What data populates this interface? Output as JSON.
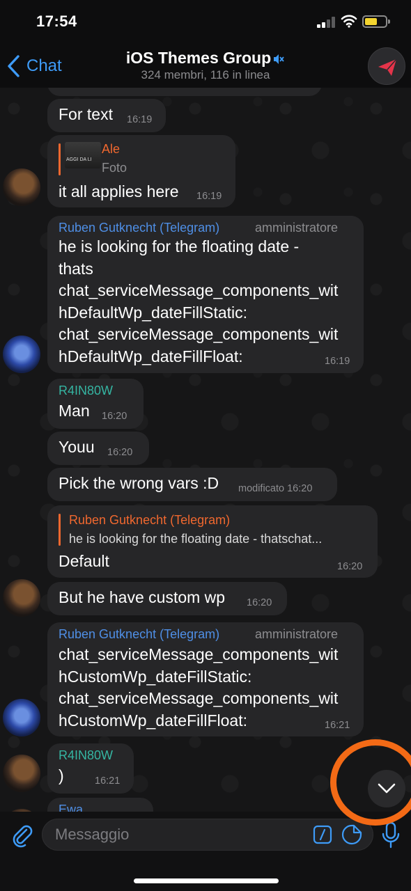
{
  "status": {
    "time": "17:54"
  },
  "nav": {
    "back_label": "Chat",
    "title": "iOS Themes Group",
    "subtitle": "324 membri, 116 in linea"
  },
  "messages": [
    {
      "text": "For text",
      "time": "16:19"
    },
    {
      "reply_name": "Ale",
      "reply_text": "Foto",
      "reply_thumb_text": "AGGI DA LI",
      "text": "it all applies here",
      "time": "16:19"
    },
    {
      "name": "Ruben Gutknecht (Telegram)",
      "role": "amministratore",
      "lines": [
        "he is looking for the floating date -",
        "thats",
        "chat_serviceMessage_components_wit",
        "hDefaultWp_dateFillStatic:",
        "chat_serviceMessage_components_wit",
        "hDefaultWp_dateFillFloat:"
      ],
      "time": "16:19"
    },
    {
      "name": "R4IN80W",
      "text": "Man",
      "time": "16:20"
    },
    {
      "text": "Youu",
      "time": "16:20"
    },
    {
      "text": "Pick the wrong vars :D",
      "time": "modificato 16:20"
    },
    {
      "reply_name": "Ruben Gutknecht (Telegram)",
      "reply_text": "he is looking for the floating date - thatschat...",
      "text": "Default",
      "time": "16:20"
    },
    {
      "text": "But he have custom wp",
      "time": "16:20"
    },
    {
      "name": "Ruben Gutknecht (Telegram)",
      "role": "amministratore",
      "lines": [
        "chat_serviceMessage_components_wit",
        "hCustomWp_dateFillStatic:",
        "chat_serviceMessage_components_wit",
        "hCustomWp_dateFillFloat:"
      ],
      "time": "16:21"
    },
    {
      "name": "R4IN80W",
      "text": ")",
      "time": "16:21"
    },
    {
      "name": "Ewa"
    }
  ],
  "input": {
    "placeholder": "Messaggio"
  },
  "colors": {
    "accent": "#3e9bf7",
    "name_blue": "#4f8fe6",
    "name_teal": "#35b5a2",
    "reply_orange": "#f0682f",
    "highlight": "#f36a16"
  }
}
